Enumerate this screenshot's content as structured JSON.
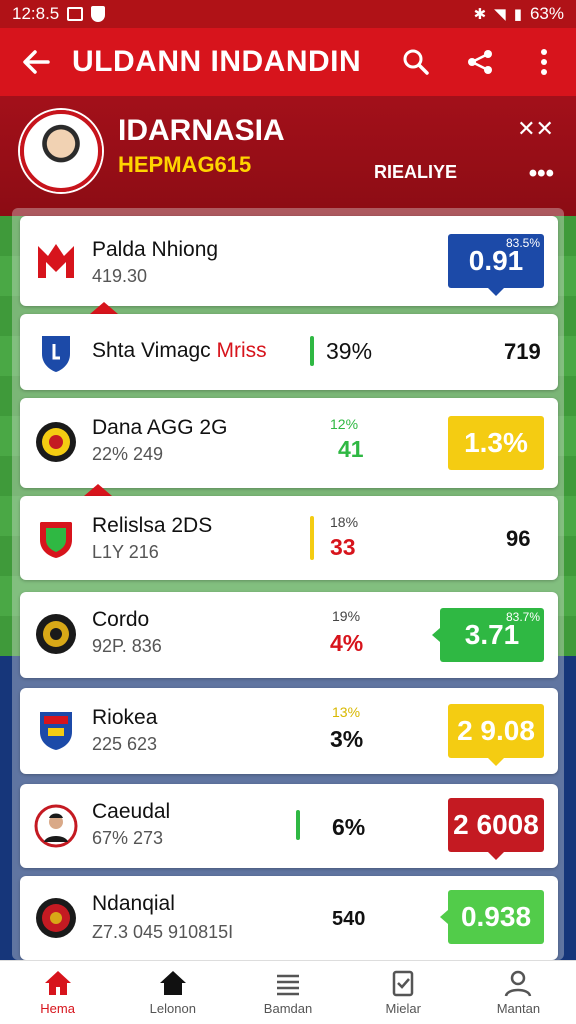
{
  "status_bar": {
    "time": "12:8.5",
    "battery": "63%",
    "icons": [
      "image-icon",
      "shield-icon",
      "bluetooth-icon",
      "wifi-icon",
      "signal-icon",
      "battery-icon"
    ]
  },
  "app_bar": {
    "title": "ULDANN INDANDIN",
    "icons": [
      "back-arrow-icon",
      "search-icon",
      "share-icon",
      "more-vert-icon"
    ]
  },
  "hero": {
    "player_name": "IDARNASIA",
    "player_sub": "HEPMAG615",
    "right_label": "RIEALIYE",
    "close_label": "✕✕",
    "more_label": "•••"
  },
  "colors": {
    "primary": "#d7141c",
    "blue": "#1c4aa8",
    "yellow": "#f4cc12",
    "green": "#2fb843",
    "dark_red": "#c41a22",
    "light_green": "#52cc4a"
  },
  "rows": [
    {
      "name": "Palda Nhiong",
      "sub": "419.30",
      "odds": "0.91",
      "odds_corner": "83.5%",
      "odds_color": "blue",
      "logo": "red-m-crest-icon"
    },
    {
      "name": "Shta Vimagc",
      "name_highlight": "Mriss",
      "sub": "",
      "bar_pct": "39%",
      "value": "719",
      "logo": "blue-shield-icon"
    },
    {
      "name": "Dana AGG 2G",
      "sub": "22% 249",
      "pct_small": "12%",
      "pct_big": "41",
      "odds": "1.3%",
      "odds_color": "yellow",
      "logo": "black-yellow-crest-icon"
    },
    {
      "name": "Relislsa 2DS",
      "sub": "L1Y 216",
      "pct_small": "18%",
      "pct_big": "33",
      "value": "96",
      "logo": "red-green-crest-icon"
    },
    {
      "name": "Cordo",
      "sub": "92P. 836",
      "pct_small": "19%",
      "pct_big": "4%",
      "odds": "3.71",
      "odds_corner": "83.7%",
      "odds_color": "green",
      "logo": "black-gold-crest-icon"
    },
    {
      "name": "Riokea",
      "sub": "225 623",
      "pct_small": "13%",
      "pct_big": "3%",
      "odds": "2 9.08",
      "odds_color": "yellow",
      "logo": "multicolor-crest-icon"
    },
    {
      "name": "Caeudal",
      "sub": "67% 273",
      "pct_big": "6%",
      "odds": "2 6008",
      "odds_color": "dark_red",
      "logo": "player-portrait-icon"
    },
    {
      "name": "Ndanqial",
      "sub": "Z7.3 045   910815I",
      "pct_big": "540",
      "odds": "0.938",
      "odds_color": "light_green",
      "logo": "red-gold-crest-icon"
    }
  ],
  "bottom_nav": [
    {
      "label": "Hema",
      "icon": "home-icon",
      "active": true
    },
    {
      "label": "Lelonon",
      "icon": "house-icon",
      "active": false
    },
    {
      "label": "Bamdan",
      "icon": "list-icon",
      "active": false
    },
    {
      "label": "Mielar",
      "icon": "clipboard-icon",
      "active": false
    },
    {
      "label": "Mantan",
      "icon": "person-icon",
      "active": false
    }
  ]
}
